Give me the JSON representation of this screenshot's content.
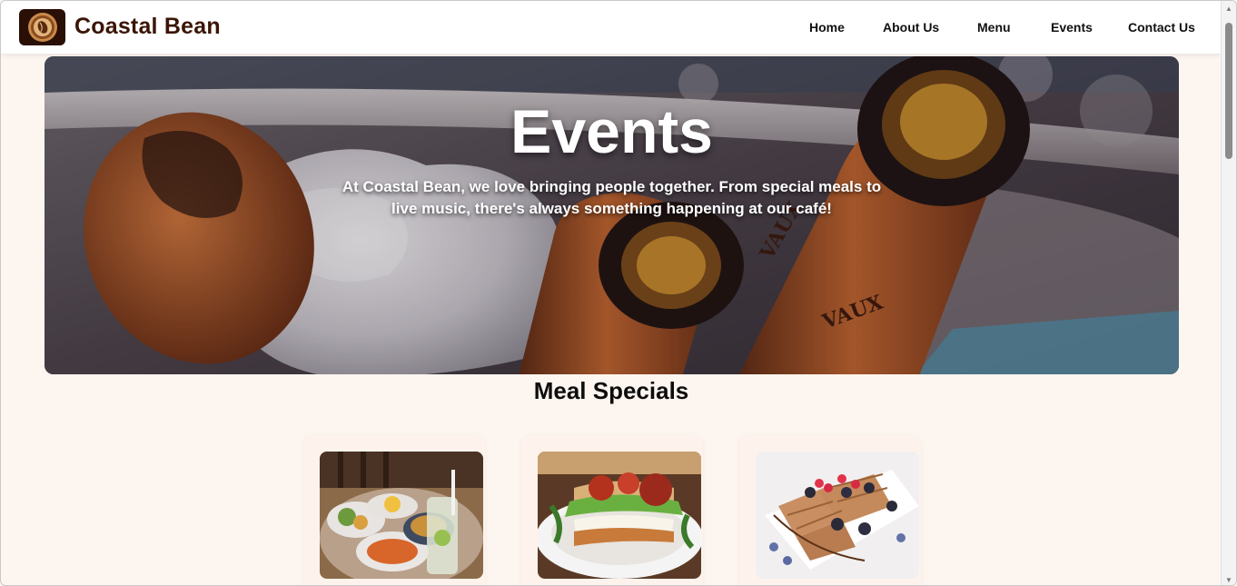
{
  "header": {
    "brand": "Coastal Bean",
    "logo_icon": "coffee-bean-logo-icon",
    "nav": [
      "Home",
      "About Us",
      "Menu",
      "Events",
      "Contact Us"
    ]
  },
  "hero": {
    "title": "Events",
    "description": "At Coastal Bean, we love bringing people together. From special meals to live music, there's always something happening at our café!",
    "image": "beer-bottles-in-ice-bucket-image"
  },
  "meal_specials": {
    "title": "Meal Specials",
    "cards": [
      {
        "image": "brunch-platter-image"
      },
      {
        "image": "sandwich-plate-image"
      },
      {
        "image": "waffles-with-berries-image"
      }
    ]
  },
  "colors": {
    "page_bg": "#fdf5f0",
    "brand": "#3a1506",
    "card_bg": "#fef3ec"
  }
}
